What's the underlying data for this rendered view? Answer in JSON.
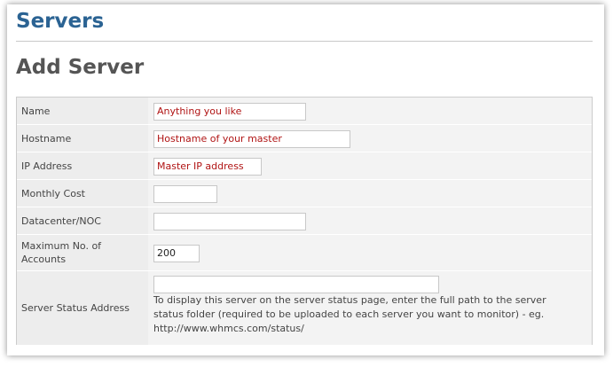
{
  "header": {
    "section_title": "Servers",
    "page_title": "Add Server"
  },
  "form": {
    "rows": [
      {
        "label": "Name",
        "value": "Anything you like",
        "placeholder": ""
      },
      {
        "label": "Hostname",
        "value": "Hostname of your master",
        "placeholder": ""
      },
      {
        "label": "IP Address",
        "value": "Master IP address",
        "placeholder": ""
      },
      {
        "label": "Monthly Cost",
        "value": "",
        "placeholder": ""
      },
      {
        "label": "Datacenter/NOC",
        "value": "",
        "placeholder": ""
      },
      {
        "label": "Maximum No. of Accounts",
        "value": "200",
        "placeholder": ""
      },
      {
        "label": "Server Status Address",
        "value": "",
        "placeholder": "",
        "help": "To display this server on the server status page, enter the full path to the server status folder (required to be uploaded to each server you want to monitor) - eg. http://www.whmcs.com/status/"
      }
    ]
  },
  "colors": {
    "title_blue": "#2b6393",
    "annotation_red": "#b01414",
    "label_bg": "#ededed",
    "field_bg": "#f3f3f3"
  }
}
